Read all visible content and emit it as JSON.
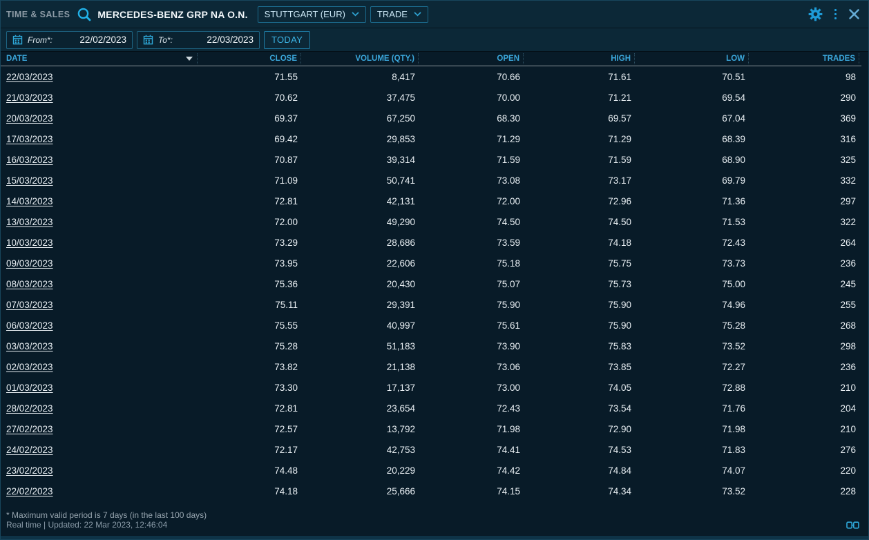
{
  "topbar": {
    "app_title": "TIME & SALES",
    "instrument": "MERCEDES-BENZ GRP NA O.N.",
    "venue_dropdown": "STUTTGART (EUR)",
    "type_dropdown": "TRADE"
  },
  "filterbar": {
    "from_label": "From*:",
    "from_value": "22/02/2023",
    "to_label": "To*:",
    "to_value": "22/03/2023",
    "today_label": "TODAY"
  },
  "table": {
    "columns": [
      "DATE",
      "CLOSE",
      "VOLUME (QTY.)",
      "OPEN",
      "HIGH",
      "LOW",
      "TRADES"
    ],
    "column_keys": [
      "date",
      "close",
      "volume",
      "open",
      "high",
      "low",
      "trades"
    ],
    "sort": {
      "column": "DATE",
      "direction": "desc"
    },
    "rows": [
      [
        "22/03/2023",
        "71.55",
        "8,417",
        "70.66",
        "71.61",
        "70.51",
        "98"
      ],
      [
        "21/03/2023",
        "70.62",
        "37,475",
        "70.00",
        "71.21",
        "69.54",
        "290"
      ],
      [
        "20/03/2023",
        "69.37",
        "67,250",
        "68.30",
        "69.57",
        "67.04",
        "369"
      ],
      [
        "17/03/2023",
        "69.42",
        "29,853",
        "71.29",
        "71.29",
        "68.39",
        "316"
      ],
      [
        "16/03/2023",
        "70.87",
        "39,314",
        "71.59",
        "71.59",
        "68.90",
        "325"
      ],
      [
        "15/03/2023",
        "71.09",
        "50,741",
        "73.08",
        "73.17",
        "69.79",
        "332"
      ],
      [
        "14/03/2023",
        "72.81",
        "42,131",
        "72.00",
        "72.96",
        "71.36",
        "297"
      ],
      [
        "13/03/2023",
        "72.00",
        "49,290",
        "74.50",
        "74.50",
        "71.53",
        "322"
      ],
      [
        "10/03/2023",
        "73.29",
        "28,686",
        "73.59",
        "74.18",
        "72.43",
        "264"
      ],
      [
        "09/03/2023",
        "73.95",
        "22,606",
        "75.18",
        "75.75",
        "73.73",
        "236"
      ],
      [
        "08/03/2023",
        "75.36",
        "20,430",
        "75.07",
        "75.73",
        "75.00",
        "245"
      ],
      [
        "07/03/2023",
        "75.11",
        "29,391",
        "75.90",
        "75.90",
        "74.96",
        "255"
      ],
      [
        "06/03/2023",
        "75.55",
        "40,997",
        "75.61",
        "75.90",
        "75.28",
        "268"
      ],
      [
        "03/03/2023",
        "75.28",
        "51,183",
        "73.90",
        "75.83",
        "73.52",
        "298"
      ],
      [
        "02/03/2023",
        "73.82",
        "21,138",
        "73.06",
        "73.85",
        "72.27",
        "236"
      ],
      [
        "01/03/2023",
        "73.30",
        "17,137",
        "73.00",
        "74.05",
        "72.88",
        "210"
      ],
      [
        "28/02/2023",
        "72.81",
        "23,654",
        "72.43",
        "73.54",
        "71.76",
        "204"
      ],
      [
        "27/02/2023",
        "72.57",
        "13,792",
        "71.98",
        "72.90",
        "71.98",
        "210"
      ],
      [
        "24/02/2023",
        "72.17",
        "42,753",
        "74.41",
        "74.53",
        "71.83",
        "276"
      ],
      [
        "23/02/2023",
        "74.48",
        "20,229",
        "74.42",
        "74.84",
        "74.07",
        "220"
      ],
      [
        "22/02/2023",
        "74.18",
        "25,666",
        "74.15",
        "74.34",
        "73.52",
        "228"
      ]
    ]
  },
  "footer": {
    "note": "* Maximum valid period is 7 days (in the last 100 days)",
    "status": "Real time | Updated: 22 Mar 2023, 12:46:04"
  },
  "colors": {
    "accent": "#26ACE2",
    "header_text": "#3BA7DB",
    "cell_text": "#E9EFF3",
    "muted_text": "#97A5AF",
    "bar_background": "#0C2837",
    "table_background": "#081B28",
    "border": "#1B6A8C"
  }
}
